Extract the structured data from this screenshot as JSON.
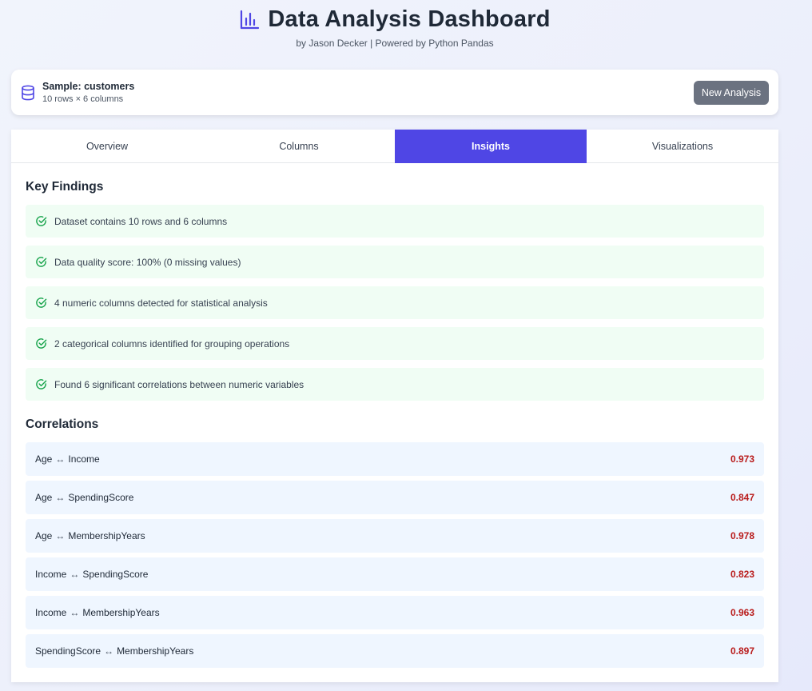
{
  "header": {
    "title": "Data Analysis Dashboard",
    "subtitle": "by Jason Decker | Powered by Python Pandas",
    "icon": "bar-chart-icon"
  },
  "dataset": {
    "icon": "database-icon",
    "name": "Sample: customers",
    "meta": "10 rows × 6 columns",
    "new_analysis_label": "New Analysis"
  },
  "tabs": [
    {
      "label": "Overview",
      "active": false
    },
    {
      "label": "Columns",
      "active": false
    },
    {
      "label": "Insights",
      "active": true
    },
    {
      "label": "Visualizations",
      "active": false
    }
  ],
  "insights": {
    "findings_title": "Key Findings",
    "findings": [
      "Dataset contains 10 rows and 6 columns",
      "Data quality score: 100% (0 missing values)",
      "4 numeric columns detected for statistical analysis",
      "2 categorical columns identified for grouping operations",
      "Found 6 significant correlations between numeric variables"
    ],
    "correlations_title": "Correlations",
    "arrow": "↔",
    "correlations": [
      {
        "a": "Age",
        "b": "Income",
        "value": "0.973"
      },
      {
        "a": "Age",
        "b": "SpendingScore",
        "value": "0.847"
      },
      {
        "a": "Age",
        "b": "MembershipYears",
        "value": "0.978"
      },
      {
        "a": "Income",
        "b": "SpendingScore",
        "value": "0.823"
      },
      {
        "a": "Income",
        "b": "MembershipYears",
        "value": "0.963"
      },
      {
        "a": "SpendingScore",
        "b": "MembershipYears",
        "value": "0.897"
      }
    ]
  },
  "colors": {
    "accent": "#4f46e5",
    "finding_bg": "#f0fdf4",
    "check": "#16a34a",
    "correlation_bg": "#eff6ff",
    "correlation_value": "#b91c1c",
    "button": "#6b7280"
  }
}
